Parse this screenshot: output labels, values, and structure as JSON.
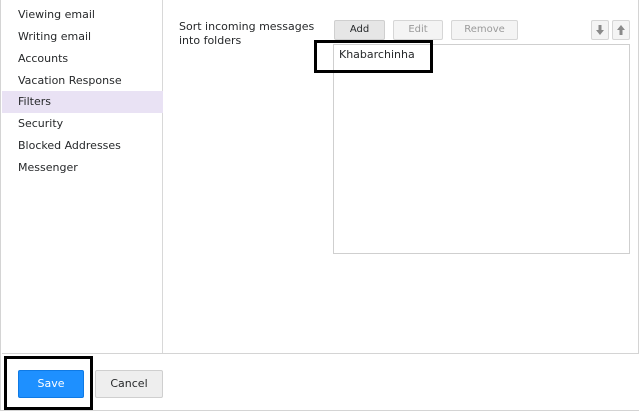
{
  "sidebar": {
    "items": [
      {
        "label": "Viewing email",
        "active": false
      },
      {
        "label": "Writing email",
        "active": false
      },
      {
        "label": "Accounts",
        "active": false
      },
      {
        "label": "Vacation Response",
        "active": false
      },
      {
        "label": "Filters",
        "active": true
      },
      {
        "label": "Security",
        "active": false
      },
      {
        "label": "Blocked Addresses",
        "active": false
      },
      {
        "label": "Messenger",
        "active": false
      }
    ]
  },
  "filters": {
    "description": "Sort incoming messages into folders",
    "add_label": "Add",
    "edit_label": "Edit",
    "remove_label": "Remove",
    "move_down_icon": "arrow-down-icon",
    "move_up_icon": "arrow-up-icon",
    "list": [
      "Khabarchinha"
    ]
  },
  "footer": {
    "save_label": "Save",
    "cancel_label": "Cancel"
  },
  "colors": {
    "active_nav_bg": "#e9e2f4",
    "save_bg": "#1e90ff",
    "highlight_border": "#000000"
  }
}
